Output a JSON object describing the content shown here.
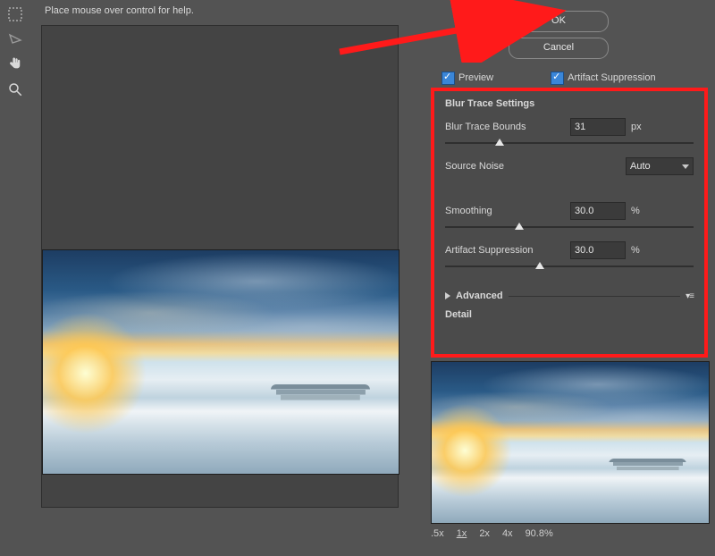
{
  "help_text": "Place mouse over control for help.",
  "buttons": {
    "ok": "OK",
    "cancel": "Cancel"
  },
  "checkboxes": {
    "preview": "Preview",
    "artifact": "Artifact Suppression"
  },
  "settings": {
    "title": "Blur Trace Settings",
    "bounds": {
      "label": "Blur Trace Bounds",
      "value": "31",
      "unit": "px",
      "slider_pct": 22
    },
    "noise": {
      "label": "Source Noise",
      "value": "Auto"
    },
    "smooth": {
      "label": "Smoothing",
      "value": "30.0",
      "unit": "%",
      "slider_pct": 30
    },
    "supp": {
      "label": "Artifact Suppression",
      "value": "30.0",
      "unit": "%",
      "slider_pct": 38
    },
    "advanced": "Advanced",
    "detail": "Detail"
  },
  "zoom": {
    "levels": [
      ".5x",
      "1x",
      "2x",
      "4x"
    ],
    "value": "90.8%"
  },
  "icons": {
    "marquee": "marquee",
    "lasso": "lasso",
    "hand": "hand",
    "zoom": "zoom"
  }
}
